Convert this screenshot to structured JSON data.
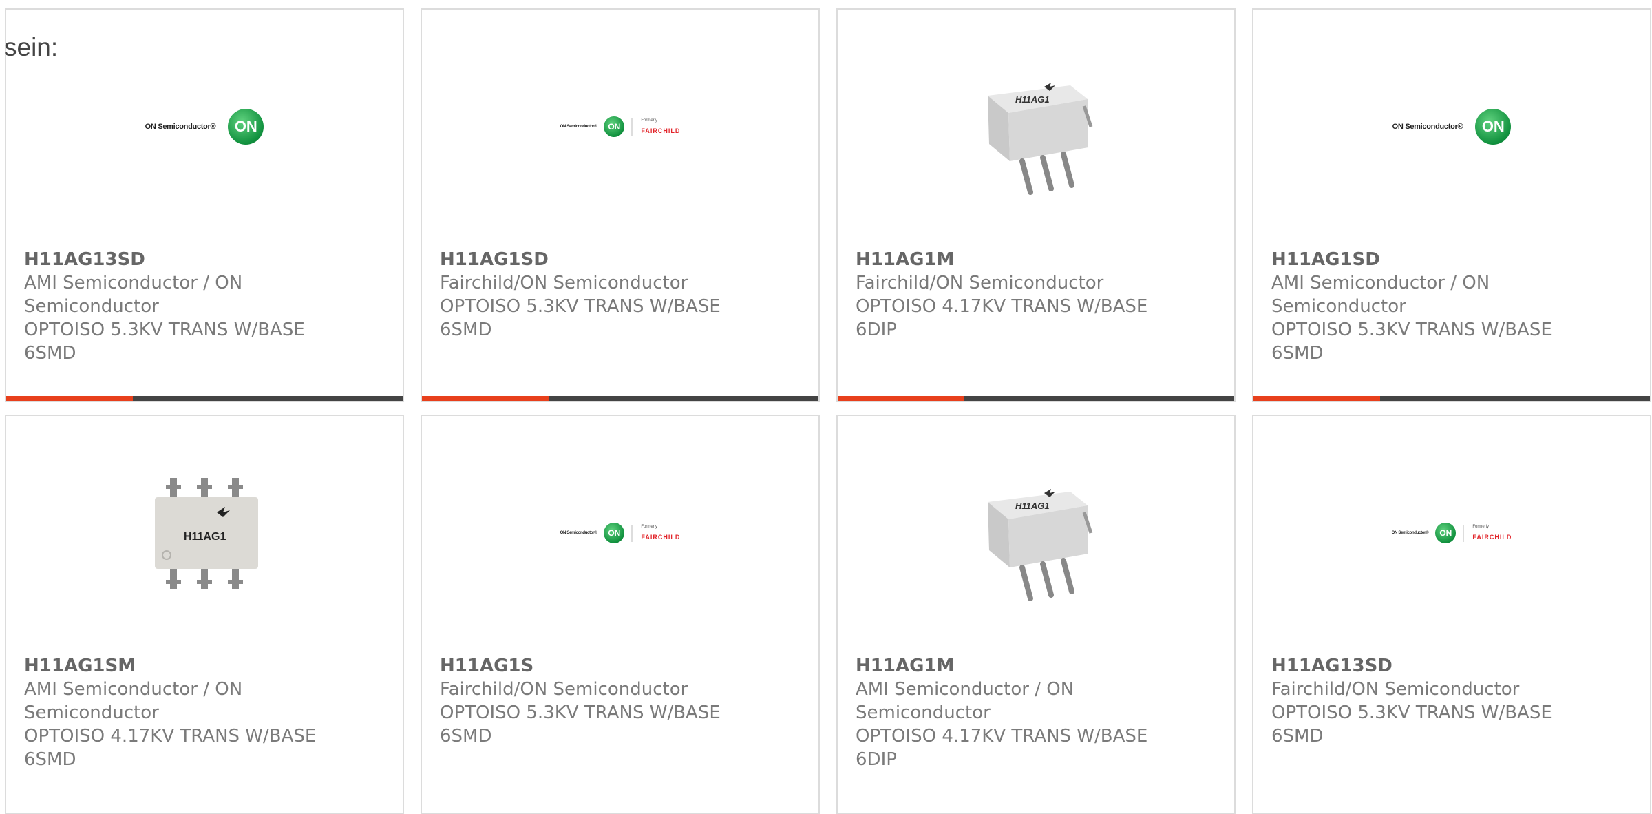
{
  "intro_text": "sein:",
  "products": [
    {
      "part": "H11AG13SD",
      "manufacturer": "AMI Semiconductor / ON Semiconductor",
      "description": "OPTOISO 5.3KV TRANS W/BASE 6SMD",
      "image": "on-semiconductor-logo"
    },
    {
      "part": "H11AG1SD",
      "manufacturer": "Fairchild/ON Semiconductor",
      "description": "OPTOISO 5.3KV TRANS W/BASE 6SMD",
      "image": "on-fairchild-logo"
    },
    {
      "part": "H11AG1M",
      "manufacturer": "Fairchild/ON Semiconductor",
      "description": "OPTOISO 4.17KV TRANS W/BASE 6DIP",
      "image": "dip-chip-photo"
    },
    {
      "part": "H11AG1SD",
      "manufacturer": "AMI Semiconductor / ON Semiconductor",
      "description": "OPTOISO 5.3KV TRANS W/BASE 6SMD",
      "image": "on-semiconductor-logo"
    },
    {
      "part": "H11AG1SM",
      "manufacturer": "AMI Semiconductor / ON Semiconductor",
      "description": "OPTOISO 4.17KV TRANS W/BASE 6SMD",
      "image": "smd-chip-photo"
    },
    {
      "part": "H11AG1S",
      "manufacturer": "Fairchild/ON Semiconductor",
      "description": "OPTOISO 5.3KV TRANS W/BASE 6SMD",
      "image": "on-fairchild-logo"
    },
    {
      "part": "H11AG1M",
      "manufacturer": "AMI Semiconductor / ON Semiconductor",
      "description": "OPTOISO 4.17KV TRANS W/BASE 6DIP",
      "image": "dip-chip-photo"
    },
    {
      "part": "H11AG13SD",
      "manufacturer": "Fairchild/ON Semiconductor",
      "description": "OPTOISO 5.3KV TRANS W/BASE 6SMD",
      "image": "on-fairchild-logo"
    }
  ],
  "logo_text": {
    "on_semiconductor": "ON Semiconductor®",
    "on": "ON",
    "formerly": "Formerly",
    "fairchild": "FAIRCHILD",
    "chip_marking": "H11AG1"
  },
  "colors": {
    "accent": "#e8401c",
    "bar": "#444444",
    "on_green": "#11913e",
    "fairchild_red": "#e2242a"
  }
}
